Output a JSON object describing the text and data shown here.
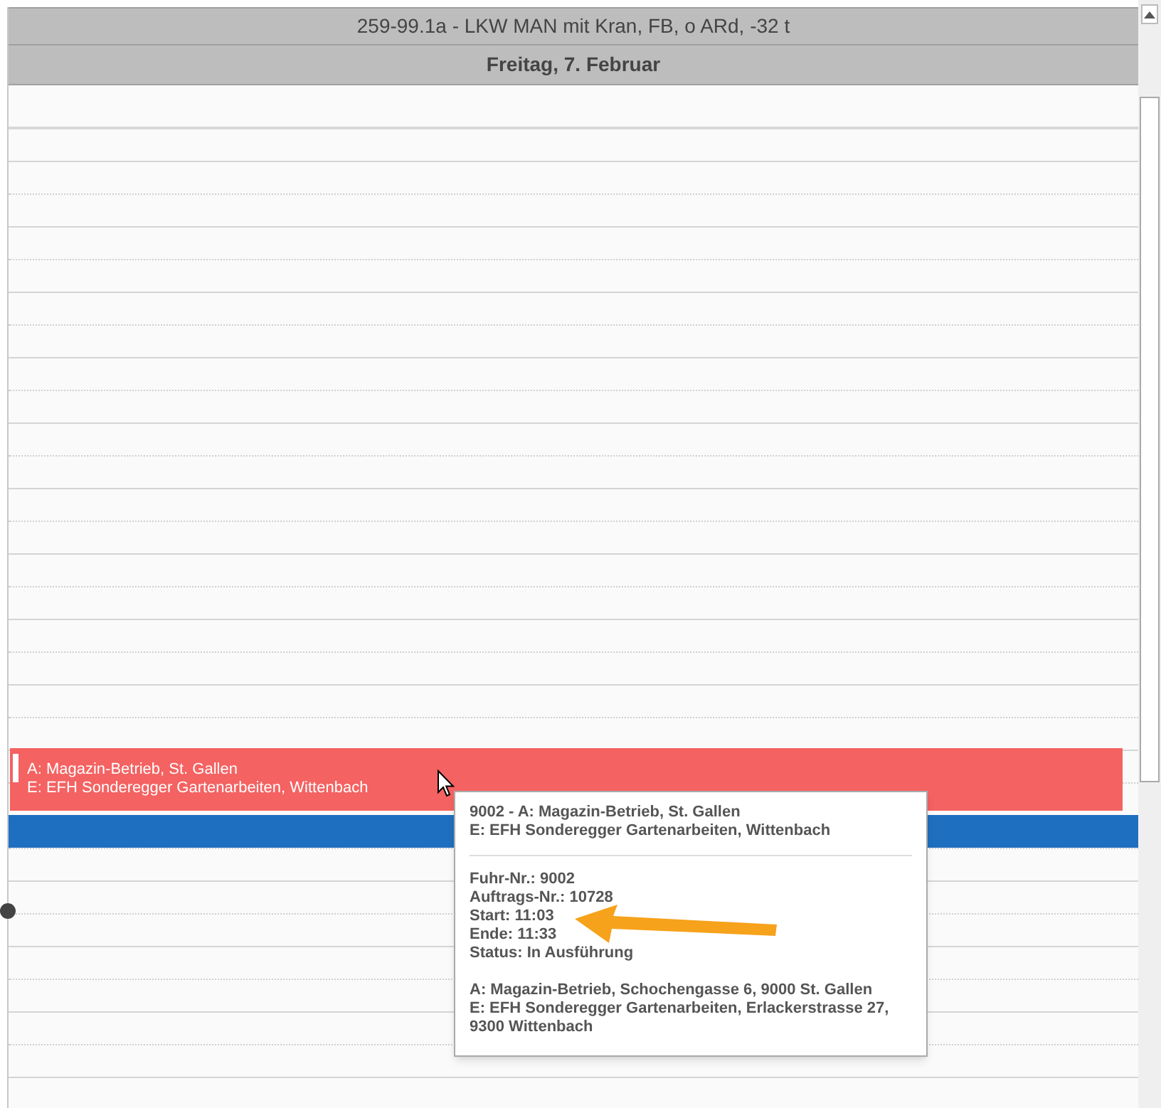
{
  "header": {
    "title": "259-99.1a - LKW MAN mit Kran, FB, o ARd, -32 t",
    "day": "Freitag, 7. Februar"
  },
  "events": [
    {
      "kind": "trip",
      "color": "#f46262",
      "lines": [
        "A: Magazin-Betrieb, St. Gallen",
        "E: EFH Sonderegger Gartenarbeiten, Wittenbach"
      ]
    },
    {
      "kind": "bar",
      "color": "#1f6fc0"
    }
  ],
  "tooltip": {
    "title": [
      "9002 - A: Magazin-Betrieb, St. Gallen",
      "E: EFH Sonderegger Gartenarbeiten, Wittenbach"
    ],
    "details": [
      "Fuhr-Nr.: 9002",
      "Auftrags-Nr.: 10728",
      "Start: 11:03",
      "Ende: 11:33",
      "Status: In Ausführung"
    ],
    "addresses": [
      "A: Magazin-Betrieb, Schochengasse 6, 9000 St. Gallen",
      "E: EFH Sonderegger Gartenarbeiten, Erlackerstrasse 27, 9300 Wittenbach"
    ]
  }
}
